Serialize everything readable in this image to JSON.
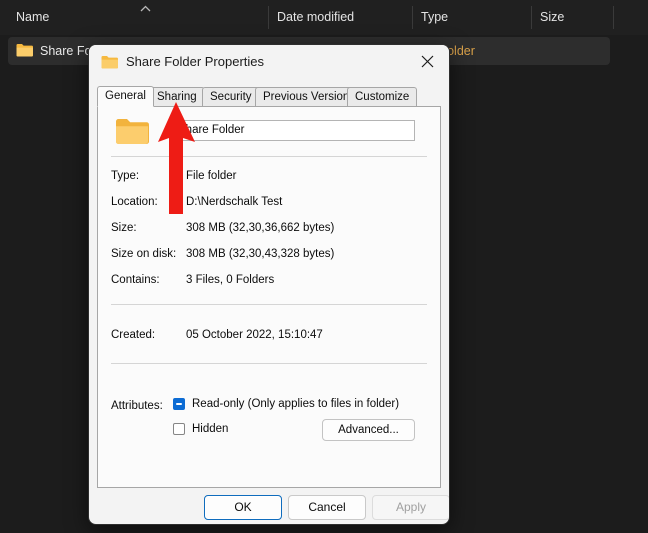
{
  "explorer": {
    "columns": [
      {
        "label": "Name"
      },
      {
        "label": "Date modified"
      },
      {
        "label": "Type"
      },
      {
        "label": "Size"
      }
    ],
    "sort_indicator": "chevron-up-icon",
    "row": {
      "icon": "folder-icon",
      "name": "Share Folder",
      "type": "File folder"
    }
  },
  "dialog": {
    "icon": "folder-icon",
    "title": "Share Folder Properties",
    "close_label": "close-icon",
    "tabs": [
      {
        "label": "General",
        "selected": true
      },
      {
        "label": "Sharing",
        "selected": false
      },
      {
        "label": "Security",
        "selected": false
      },
      {
        "label": "Previous Versions",
        "selected": false
      },
      {
        "label": "Customize",
        "selected": false
      }
    ],
    "general": {
      "folder_icon": "folder-icon",
      "name_value": "Share Folder",
      "fields": [
        {
          "label": "Type:",
          "value": "File folder"
        },
        {
          "label": "Location:",
          "value": "D:\\Nerdschalk Test"
        },
        {
          "label": "Size:",
          "value": "308 MB (32,30,36,662 bytes)"
        },
        {
          "label": "Size on disk:",
          "value": "308 MB (32,30,43,328 bytes)"
        },
        {
          "label": "Contains:",
          "value": "3 Files, 0 Folders"
        },
        {
          "label": "Created:",
          "value": "05 October 2022, 15:10:47"
        }
      ],
      "attributes": {
        "label": "Attributes:",
        "readonly_label": "Read-only (Only applies to files in folder)",
        "readonly_state": "indeterminate",
        "hidden_label": "Hidden",
        "hidden_state": "unchecked",
        "advanced_label": "Advanced..."
      }
    },
    "buttons": {
      "ok": "OK",
      "cancel": "Cancel",
      "apply": "Apply"
    }
  },
  "annotation": {
    "arrow": "red-arrow-pointing-up",
    "color": "#ee1c15"
  }
}
